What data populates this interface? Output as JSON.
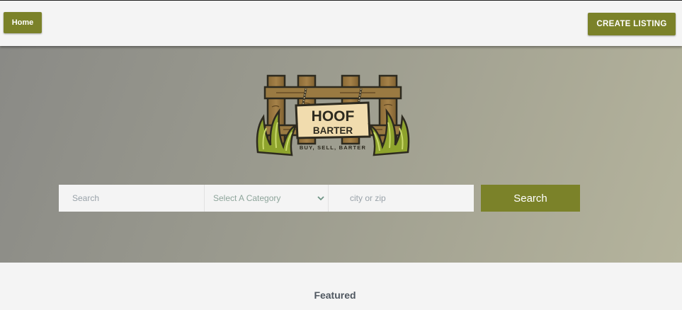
{
  "nav": {
    "home_label": "Home",
    "create_listing_label": "CREATE LISTING"
  },
  "logo": {
    "line1": "HOOF",
    "line2": "BARTER",
    "tagline": "BUY, SELL, BARTER"
  },
  "search": {
    "keyword_placeholder": "Search",
    "category_selected": "Select A Category",
    "location_placeholder": "city or zip",
    "button_label": "Search"
  },
  "featured": {
    "heading": "Featured"
  },
  "colors": {
    "accent": "#7b8229",
    "hero_gradient_start": "#8a8a86",
    "hero_gradient_end": "#b5b49d",
    "page_background": "#f4f4f4"
  }
}
